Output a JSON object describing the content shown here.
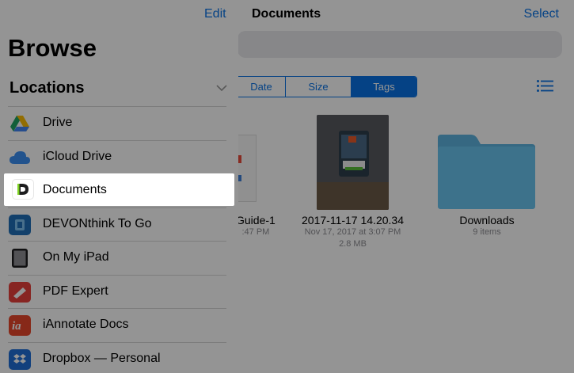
{
  "main": {
    "title": "Documents",
    "select_label": "Select",
    "sort_tabs": [
      {
        "label": "Date",
        "active": false
      },
      {
        "label": "Size",
        "active": false
      },
      {
        "label": "Tags",
        "active": true
      }
    ],
    "files": [
      {
        "name": "Guide-1",
        "meta1": ":47 PM",
        "meta2": ""
      },
      {
        "name": "2017-11-17 14.20.34",
        "meta1": "Nov 17, 2017 at 3:07 PM",
        "meta2": "2.8 MB"
      },
      {
        "name": "Downloads",
        "meta1": "9 items",
        "meta2": ""
      }
    ]
  },
  "sidebar": {
    "edit_label": "Edit",
    "title": "Browse",
    "section": "Locations",
    "items": [
      {
        "label": "Drive",
        "icon": "google-drive-icon"
      },
      {
        "label": "iCloud Drive",
        "icon": "icloud-icon"
      },
      {
        "label": "Documents",
        "icon": "documents-app-icon",
        "selected": true
      },
      {
        "label": "DEVONthink To Go",
        "icon": "devonthink-icon"
      },
      {
        "label": "On My iPad",
        "icon": "ipad-icon"
      },
      {
        "label": "PDF Expert",
        "icon": "pdf-expert-icon"
      },
      {
        "label": "iAnnotate Docs",
        "icon": "iannotate-icon"
      },
      {
        "label": "Dropbox — Personal",
        "icon": "dropbox-icon"
      }
    ]
  },
  "colors": {
    "accent": "#0a73e6",
    "folder": "#6ac4f0"
  }
}
